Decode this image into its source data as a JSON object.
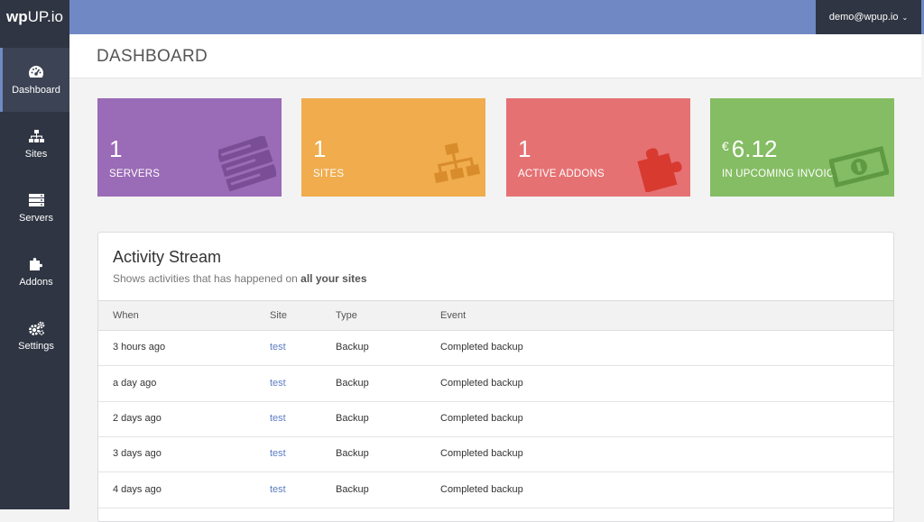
{
  "app": {
    "logo_bold": "wp",
    "logo_rest": "UP.io"
  },
  "user": {
    "email": "demo@wpup.io"
  },
  "sidebar": {
    "items": [
      {
        "label": "Dashboard",
        "icon": "dashboard-icon",
        "active": true
      },
      {
        "label": "Sites",
        "icon": "sitemap-icon"
      },
      {
        "label": "Servers",
        "icon": "server-icon"
      },
      {
        "label": "Addons",
        "icon": "puzzle-icon"
      },
      {
        "label": "Settings",
        "icon": "gears-icon"
      }
    ]
  },
  "page": {
    "title": "DASHBOARD"
  },
  "tiles": [
    {
      "value": "1",
      "label": "SERVERS",
      "color": "#9a6bb6",
      "icon": "server-icon"
    },
    {
      "value": "1",
      "label": "SITES",
      "color": "#f0ac4d",
      "icon": "sitemap-icon"
    },
    {
      "value": "1",
      "label": "ACTIVE ADDONS",
      "color": "#e57173",
      "icon": "puzzle-icon"
    },
    {
      "value": "6.12",
      "currency": "€",
      "label": "IN UPCOMING INVOICE",
      "color": "#84bd63",
      "icon": "money-icon"
    }
  ],
  "activity": {
    "title": "Activity Stream",
    "subtitle_prefix": "Shows activities that has happened on",
    "subtitle_bold": "all your sites",
    "columns": [
      "When",
      "Site",
      "Type",
      "Event"
    ],
    "rows": [
      {
        "when": "3 hours ago",
        "site": "test",
        "type": "Backup",
        "event": "Completed backup"
      },
      {
        "when": "a day ago",
        "site": "test",
        "type": "Backup",
        "event": "Completed backup"
      },
      {
        "when": "2 days ago",
        "site": "test",
        "type": "Backup",
        "event": "Completed backup"
      },
      {
        "when": "3 days ago",
        "site": "test",
        "type": "Backup",
        "event": "Completed backup"
      },
      {
        "when": "4 days ago",
        "site": "test",
        "type": "Backup",
        "event": "Completed backup"
      }
    ]
  }
}
